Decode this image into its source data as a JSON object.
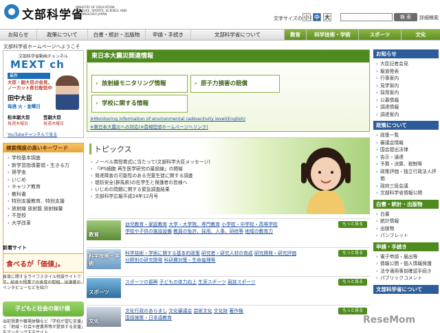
{
  "header": {
    "logo_text": "文部科学省",
    "logo_sub": "MINISTRY OF EDUCATION, CULTURE, SPORTS, SCIENCE AND TECHNOLOGY-JAPAN",
    "font_size_label": "文字サイズの変更",
    "font_sizes": [
      "小",
      "中",
      "大"
    ],
    "search_placeholder": "",
    "search_button": "検 索",
    "advanced_search": "詳細検索"
  },
  "global_nav": [
    {
      "label": "お知らせ",
      "active": false
    },
    {
      "label": "政策について",
      "active": false
    },
    {
      "label": "白書・統計・出版物",
      "active": false
    },
    {
      "label": "申請・手続き",
      "active": false
    },
    {
      "label": "文部科学省について",
      "active": false
    },
    {
      "label": "教育",
      "active": true
    },
    {
      "label": "科学技術・学術",
      "active": true
    },
    {
      "label": "スポーツ",
      "active": true
    },
    {
      "label": "文化",
      "active": true
    }
  ],
  "breadcrumb": "文部科学省ホームページへようこそ",
  "mext_channel": {
    "caption": "文部科学省動画チャンネル",
    "logo": "MEXT ch",
    "latest": "最新",
    "headline": "大臣・副大臣の会見、ノーカット即日配信中",
    "minister": "田中大臣",
    "onair_1": "毎週 火・金曜日",
    "minister_2": "松本副大臣",
    "minister_3": "笠副大臣",
    "onair_2": "毎週木曜日",
    "onair_3": "毎週木曜日",
    "youtube_link": "YouTubeチャンネルで見る"
  },
  "keywords": {
    "title": "検索頻度の高いキーワード",
    "items": [
      "学校基本調査",
      "新学習指導要領・生きる力",
      "奨学金",
      "いじめ",
      "キャリア教育",
      "教科書",
      "特別支援教育、特別支援",
      "放射線 放射能 放射線量",
      "不登校",
      "大学改革"
    ]
  },
  "new_sites": {
    "title": "新着サイト",
    "food_banner": "食べるが「価値」。",
    "food_desc": "食育に関するライフスタイル特設サイトです。給食や授業での食育の取組、出演者のインタビューなどを紹介",
    "kids_banner": "子どもと社会の架け橋",
    "kids_desc": "出前授業や職場体験など「学校が望む支援」と「地域・社会や産業界等が提供する支援」をマッチングするサイト"
  },
  "quake": {
    "title": "東日本大震災関連情報",
    "buttons": [
      "放射線モニタリング情報",
      "原子力損害の賠償",
      "学校に関する情報"
    ],
    "link_1": "※Monitoring information of environmental radioactivity level(English)",
    "link_2": "※東日本大震災への対応(※首相官邸ホームページへリンク)"
  },
  "topics": {
    "title": "トピックス",
    "items": [
      "ノーベル賞授賞式に当たって(文部科学大臣メッセージ)",
      "「iPS細胞 再生医学研究の最前線」の開催",
      "発達障害の可能性のある児童生徒に関する調査",
      "堤防安全(群馬県)の在学生と保護者の皆様へ",
      "いじめの問題に関する緊急調査結果",
      "文部科学広報平成24年12月号"
    ]
  },
  "categories": [
    {
      "label": "教育",
      "more": "もっと見る",
      "links": [
        "幼児教育・家庭教育",
        "大学・大学院、専門教育",
        "小学校・中学校・高等学校",
        "学校や子供の施設設備",
        "教員の免許、採用、人事、研修等",
        "地域の教育力"
      ]
    },
    {
      "label": "科学技術・学術",
      "more": "もっと見る",
      "links": [
        "科学技術・学術に関する基本的政策",
        "研究者・研究人材の育成",
        "研究開発・研究評価",
        "分野別の研究開発",
        "科研費対策・生命倫理等"
      ]
    },
    {
      "label": "スポーツ",
      "more": "もっと見る",
      "links": [
        "スポーツの振興",
        "子どもの体力向上",
        "生涯スポーツ",
        "競技スポーツ"
      ]
    },
    {
      "label": "文化",
      "more": "もっと見る",
      "links": [
        "文化行政のあらまし",
        "文化審議会",
        "芸術文化",
        "文化財",
        "著作権",
        "国語施策・日本語教育"
      ]
    }
  ],
  "right_col": {
    "notices": {
      "title": "お知らせ",
      "items": [
        "大臣記者会見",
        "報道発表",
        "行事案内",
        "見学案内",
        "採用案内",
        "公募情報",
        "調達情報",
        "調達案内"
      ]
    },
    "policy": {
      "title": "政策について",
      "items": [
        "政策一覧",
        "審議会情報",
        "国会提出法律",
        "告示・通達",
        "予算・決算、税制等",
        "政策評価・独立行政法人評価",
        "政府三役会議",
        "文部科学省情報公開"
      ]
    },
    "white_paper": {
      "title": "白書・統計・出版物",
      "items": [
        "白書",
        "統計情報",
        "出版物",
        "パンフレット"
      ]
    },
    "application": {
      "title": "申請・手続き",
      "items": [
        "電子申請・届出等",
        "情報公開・個人情報保護",
        "法令適用事前確認手続き",
        "パブリックコメント"
      ]
    },
    "about": {
      "title": "文部科学省について"
    }
  },
  "watermark": "ReseMom"
}
